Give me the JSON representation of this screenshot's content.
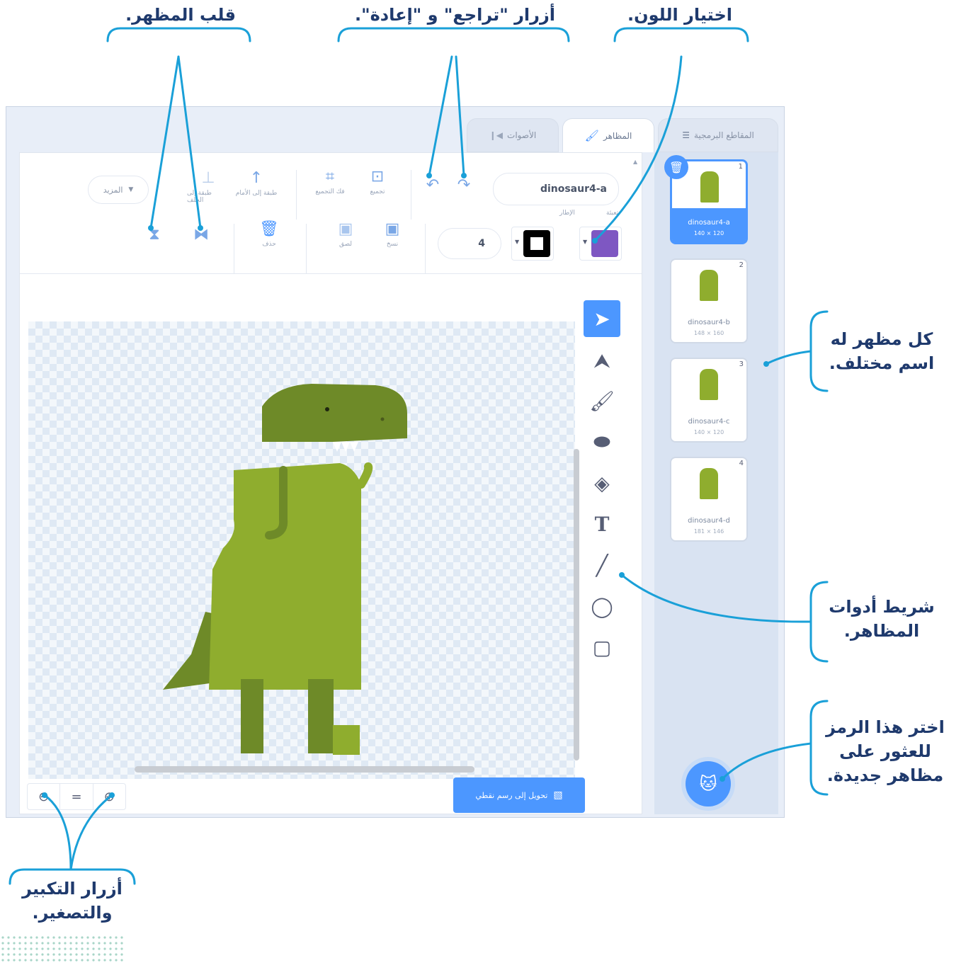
{
  "callouts": {
    "flip": "قلب المظهر.",
    "undo_redo": "أزرار \"تراجع\" و \"إعادة\".",
    "color": "اختيار اللون.",
    "names": "كل مظهر له اسم مختلف.",
    "toolbar": "شريط أدوات المظاهر.",
    "new_costume": "اختر هذا الرمز للعثور على مظاهر جديدة.",
    "zoom": "أزرار التكبير والتصغير."
  },
  "tabs": [
    {
      "label": "الأصوات",
      "icon": "sound-icon"
    },
    {
      "label": "المظاهر",
      "icon": "brush-icon"
    },
    {
      "label": "المقاطع البرمجية",
      "icon": "code-icon"
    }
  ],
  "editor": {
    "costume_name": "dinosaur4-a",
    "outline_width": "4",
    "fill_label": "تعبئة",
    "outline_label": "الإطار",
    "more_label": "المزيد",
    "group_label": "تجميع",
    "ungroup_label": "فك التجميع",
    "forward_label": "طبقة إلى الأمام",
    "backward_label": "طبقة إلى الخلف",
    "copy_label": "نسخ",
    "paste_label": "لصق",
    "delete_label": "حذف",
    "convert_label": "تحويل إلى رسم نقطي",
    "zoom_reset": "="
  },
  "costumes": [
    {
      "num": "1",
      "name": "dinosaur4-a",
      "size": "140 × 120"
    },
    {
      "num": "2",
      "name": "dinosaur4-b",
      "size": "148 × 160"
    },
    {
      "num": "3",
      "name": "dinosaur4-c",
      "size": "140 × 120"
    },
    {
      "num": "4",
      "name": "dinosaur4-d",
      "size": "181 × 146"
    }
  ],
  "colors": {
    "accent": "#4c97ff",
    "fill": "#7e57c2",
    "callout_line": "#1aa0d8",
    "dino_main": "#8fad2e",
    "dino_dark": "#6e8a28"
  }
}
